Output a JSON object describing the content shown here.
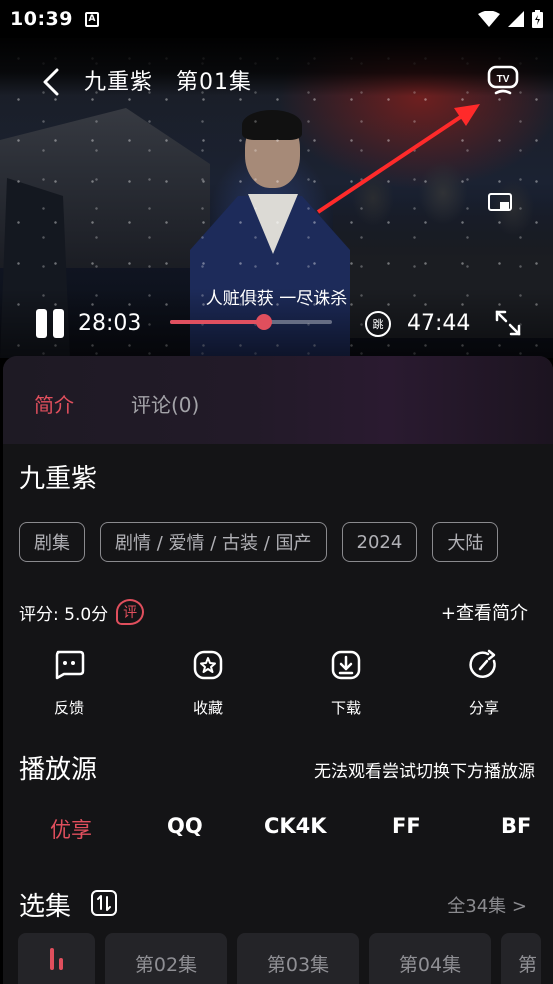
{
  "status_bar": {
    "time": "10:39",
    "notif_icon": "A"
  },
  "player": {
    "title": "九重紫　第01集",
    "subtitle": "人赃俱获 一尽诛杀",
    "current_time": "28:03",
    "total_time": "47:44",
    "progress": 0.58,
    "skip_label": "跳"
  },
  "tabs": {
    "intro": "简介",
    "comments": "评论(0)"
  },
  "show": {
    "title": "九重紫",
    "tags": [
      "剧集",
      "剧情 / 爱情 / 古装 / 国产",
      "2024",
      "大陆"
    ],
    "rating": "评分: 5.0分",
    "rate_icon": "评",
    "intro_link": "+查看简介"
  },
  "actions": [
    {
      "label": "反馈",
      "icon": "feedback-icon"
    },
    {
      "label": "收藏",
      "icon": "star-icon"
    },
    {
      "label": "下载",
      "icon": "download-icon"
    },
    {
      "label": "分享",
      "icon": "share-icon"
    }
  ],
  "sources": {
    "title": "播放源",
    "hint": "无法观看尝试切换下方播放源",
    "items": [
      "优享",
      "QQ",
      "CK4K",
      "FF",
      "BF"
    ],
    "active_index": 0
  },
  "episodes": {
    "title": "选集",
    "all_label": "全34集 >",
    "items": [
      "第02集",
      "第03集",
      "第04集",
      "第"
    ]
  },
  "colors": {
    "accent": "#e04f5d",
    "panel": "#141416"
  }
}
